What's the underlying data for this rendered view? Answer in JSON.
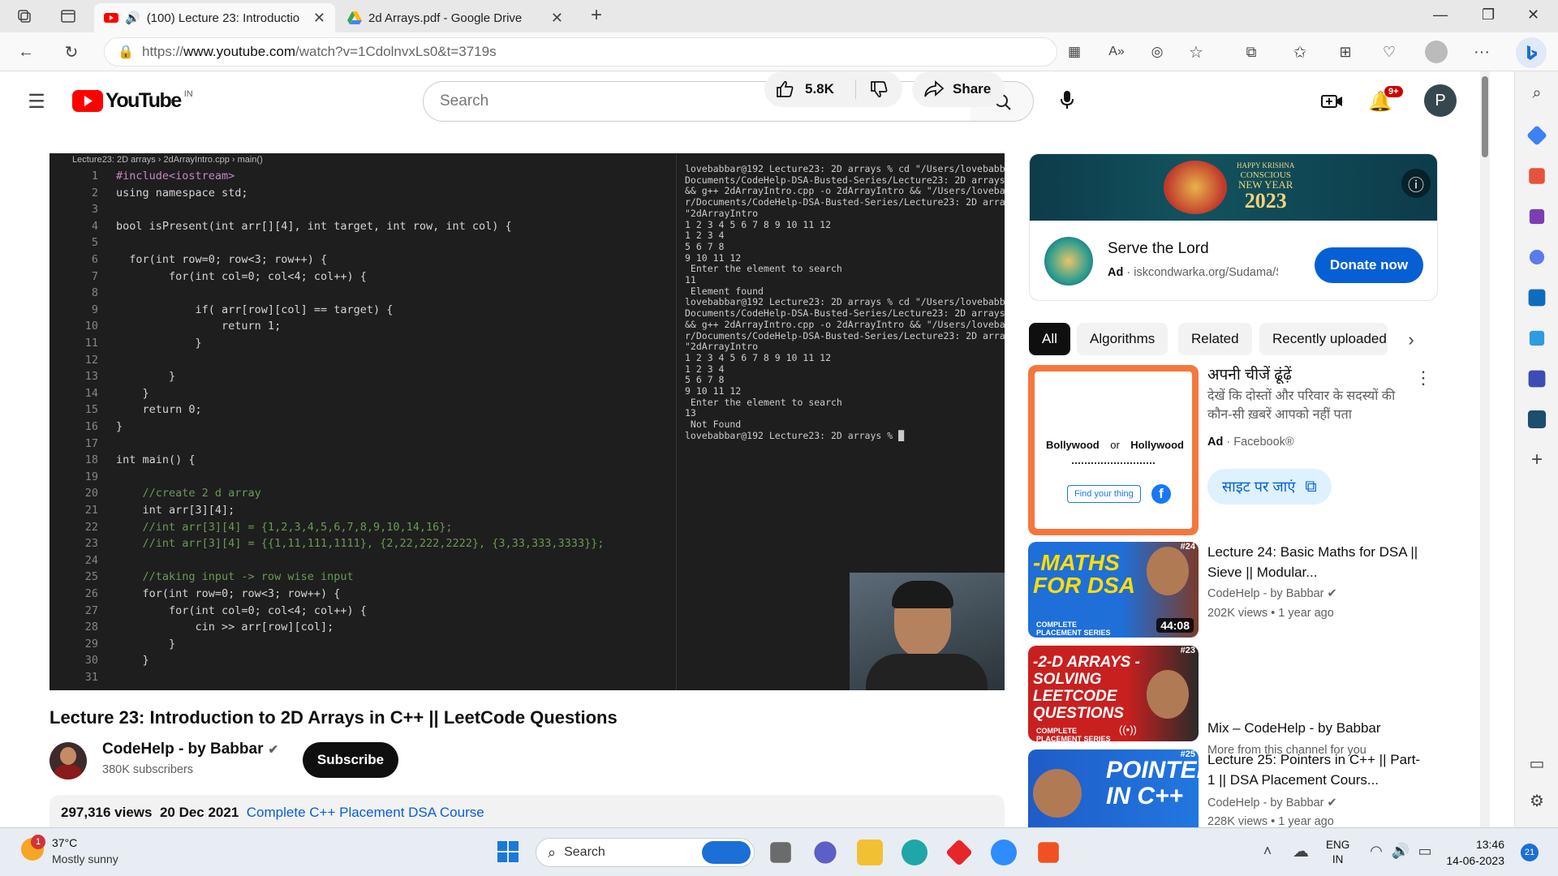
{
  "browser": {
    "tabs": [
      {
        "title": "(100) Lecture 23: Introductio"
      },
      {
        "title": "2d Arrays.pdf - Google Drive"
      }
    ],
    "url_prefix": "https://",
    "url_domain": "www.youtube.com",
    "url_path": "/watch?v=1CdolnvxLs0&t=3719s"
  },
  "youtube": {
    "logo_text": "YouTube",
    "region": "IN",
    "search_placeholder": "Search",
    "notifications_badge": "9+",
    "avatar_letter": "P",
    "video": {
      "breadcrumb": "Lecture23: 2D arrays  ›  2dArrayIntro.cpp  ›  main()",
      "code_lines": [
        {
          "n": "1",
          "t": "#include<iostream>"
        },
        {
          "n": "2",
          "t": "using namespace std;"
        },
        {
          "n": "3",
          "t": ""
        },
        {
          "n": "4",
          "t": "bool isPresent(int arr[][4], int target, int row, int col) {"
        },
        {
          "n": "5",
          "t": ""
        },
        {
          "n": "6",
          "t": "  for(int row=0; row<3; row++) {"
        },
        {
          "n": "7",
          "t": "        for(int col=0; col<4; col++) {"
        },
        {
          "n": "8",
          "t": ""
        },
        {
          "n": "9",
          "t": "            if( arr[row][col] == target) {"
        },
        {
          "n": "10",
          "t": "                return 1;"
        },
        {
          "n": "11",
          "t": "            }"
        },
        {
          "n": "12",
          "t": ""
        },
        {
          "n": "13",
          "t": "        }"
        },
        {
          "n": "14",
          "t": "    }"
        },
        {
          "n": "15",
          "t": "    return 0;"
        },
        {
          "n": "16",
          "t": "}"
        },
        {
          "n": "17",
          "t": ""
        },
        {
          "n": "18",
          "t": "int main() {"
        },
        {
          "n": "19",
          "t": ""
        },
        {
          "n": "20",
          "t": "    //create 2 d array"
        },
        {
          "n": "21",
          "t": "    int arr[3][4];"
        },
        {
          "n": "22",
          "t": "    //int arr[3][4] = {1,2,3,4,5,6,7,8,9,10,14,16};"
        },
        {
          "n": "23",
          "t": "    //int arr[3][4] = {{1,11,111,1111}, {2,22,222,2222}, {3,33,333,3333}};"
        },
        {
          "n": "24",
          "t": ""
        },
        {
          "n": "25",
          "t": "    //taking input -> row wise input"
        },
        {
          "n": "26",
          "t": "    for(int row=0; row<3; row++) {"
        },
        {
          "n": "27",
          "t": "        for(int col=0; col<4; col++) {"
        },
        {
          "n": "28",
          "t": "            cin >> arr[row][col];"
        },
        {
          "n": "29",
          "t": "        }"
        },
        {
          "n": "30",
          "t": "    }"
        },
        {
          "n": "31",
          "t": ""
        }
      ],
      "terminal": "lovebabbar@192 Lecture23: 2D arrays % cd \"/Users/lovebabba\nDocuments/CodeHelp-DSA-Busted-Series/Lecture23: 2D arrays/\n&& g++ 2dArrayIntro.cpp -o 2dArrayIntro && \"/Users/lovebab\nr/Documents/CodeHelp-DSA-Busted-Series/Lecture23: 2D array\n\"2dArrayIntro\n1 2 3 4 5 6 7 8 9 10 11 12\n1 2 3 4\n5 6 7 8\n9 10 11 12\n Enter the element to search\n11\n Element found\nlovebabbar@192 Lecture23: 2D arrays % cd \"/Users/lovebabba\nDocuments/CodeHelp-DSA-Busted-Series/Lecture23: 2D arrays/\n&& g++ 2dArrayIntro.cpp -o 2dArrayIntro && \"/Users/lovebab\nr/Documents/CodeHelp-DSA-Busted-Series/Lecture23: 2D array\n\"2dArrayIntro\n1 2 3 4 5 6 7 8 9 10 11 12\n1 2 3 4\n5 6 7 8\n9 10 11 12\n Enter the element to search\n13\n Not Found\nlovebabbar@192 Lecture23: 2D arrays % █"
    },
    "title": "Lecture 23: Introduction to 2D Arrays in C++ || LeetCode Questions",
    "channel": {
      "name": "CodeHelp - by Babbar",
      "subs": "380K subscribers",
      "subscribe": "Subscribe"
    },
    "actions": {
      "likes": "5.8K",
      "share": "Share"
    },
    "desc": {
      "views": "297,316 views",
      "date": "20 Dec 2021",
      "playlist": "Complete C++ Placement DSA Course"
    },
    "ad1": {
      "banner_line1": "HAPPY KRISHNA",
      "banner_line2": "CONSCIOUS",
      "banner_line3": "NEW YEAR",
      "banner_year": "2023",
      "title": "Serve the Lord",
      "ad_label": "Ad",
      "domain": "iskcondwarka.org/Sudama/Se",
      "cta": "Donate now"
    },
    "chips": [
      "All",
      "Algorithms",
      "Related",
      "Recently uploaded"
    ],
    "ad2": {
      "title": "अपनी चीजें ढूंढ़ें",
      "body": "देखें कि दोस्तों और परिवार के सदस्यों की कौन-सी ख़बरें आपको नहीं पता",
      "ad_label": "Ad",
      "sponsor": "Facebook®",
      "cta": "साइट पर जाएं",
      "thumb_a": "Bollywood",
      "thumb_or": "or",
      "thumb_b": "Hollywood",
      "thumb_btn": "Find your thing"
    },
    "recs": [
      {
        "title": "Lecture 24: Basic Maths for DSA || Sieve || Modular...",
        "channel": "CodeHelp - by Babbar",
        "meta": "202K views • 1 year ago",
        "thumb_text": "-MATHS FOR DSA",
        "badge": "#24",
        "duration": "44:08",
        "series": "COMPLETE PLACEMENT SERIES"
      },
      {
        "title": "Mix – CodeHelp - by Babbar",
        "channel": "More from this channel for you",
        "meta": "",
        "thumb_text": "-2-D ARRAYS -SOLVING LEETCODE QUESTIONS",
        "badge": "#23",
        "series": "COMPLETE PLACEMENT SERIES"
      },
      {
        "title": "Lecture 25: Pointers in C++ || Part-1 || DSA Placement Cours...",
        "channel": "CodeHelp - by Babbar",
        "meta": "228K views • 1 year ago",
        "thumb_text": "POINTERS IN C++",
        "badge": "#25"
      }
    ]
  },
  "taskbar": {
    "temp": "37°C",
    "weather": "Mostly sunny",
    "weather_badge": "1",
    "search": "Search",
    "lang1": "ENG",
    "lang2": "IN",
    "time": "13:46",
    "date": "14-06-2023",
    "notif": "21"
  }
}
